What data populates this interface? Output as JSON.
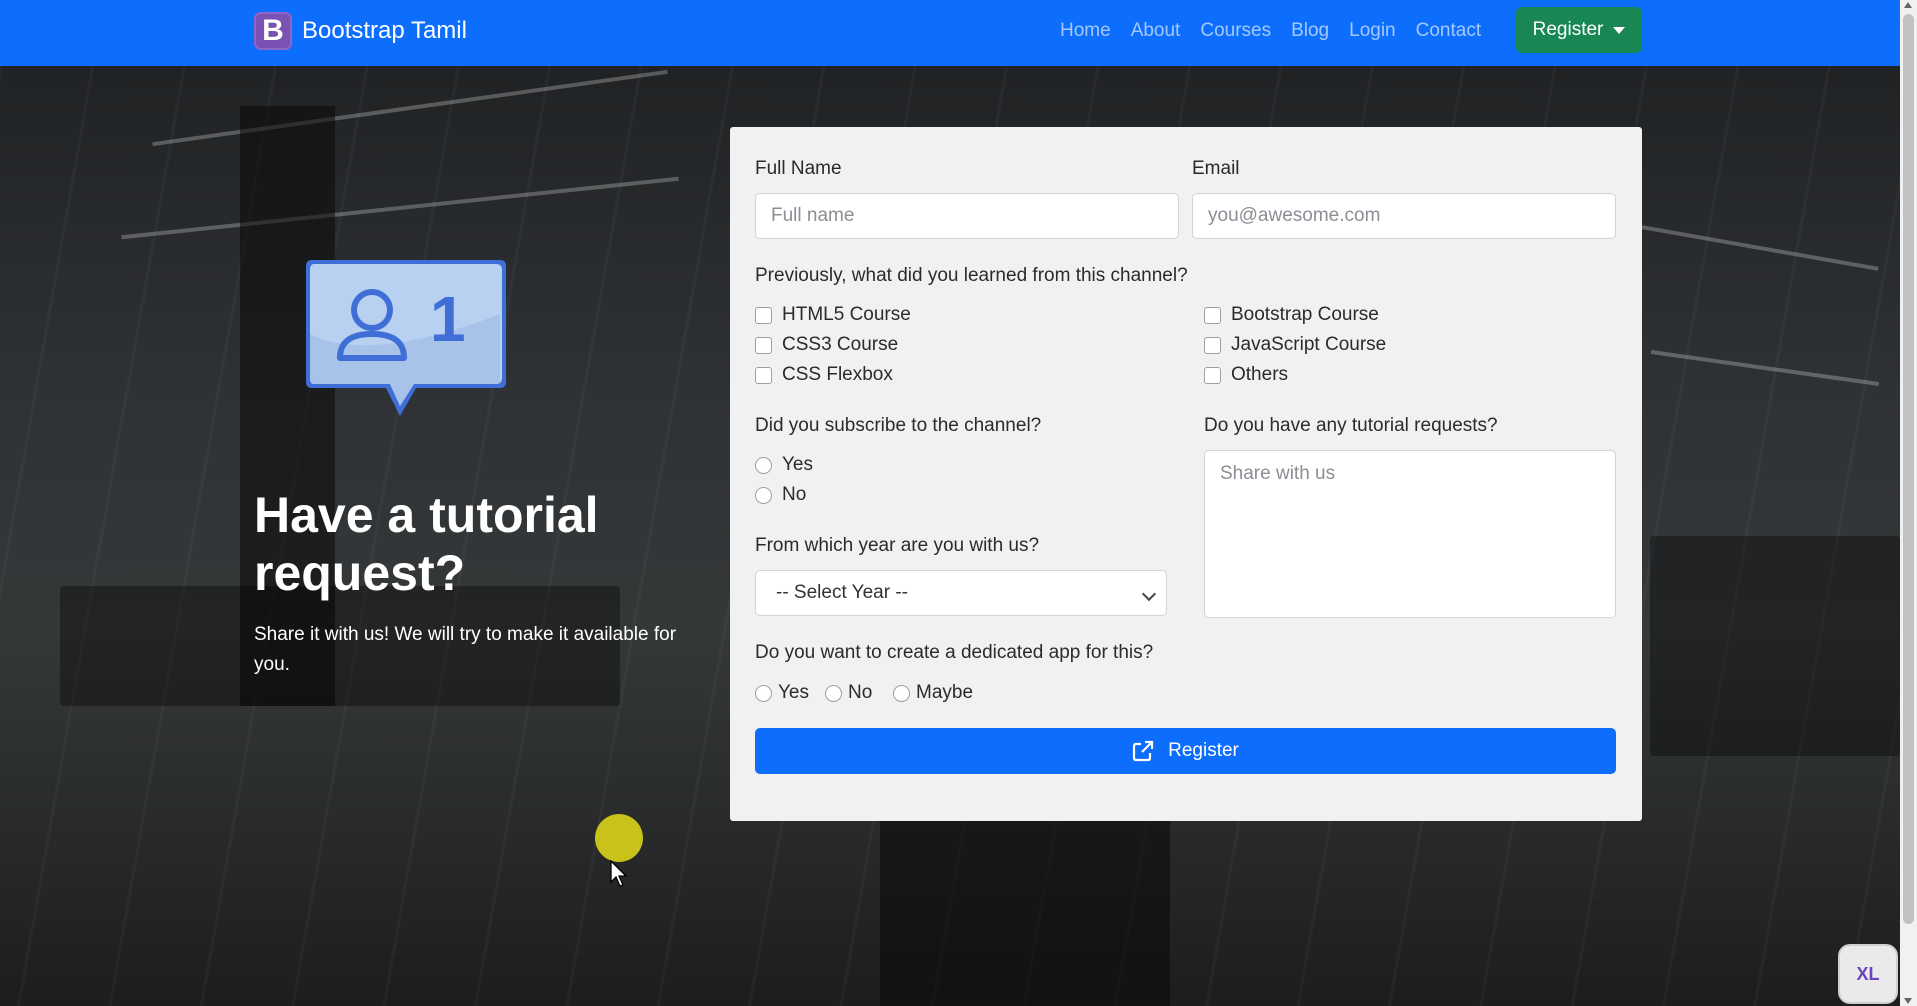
{
  "navbar": {
    "brand_letter": "B",
    "brand_name": "Bootstrap Tamil",
    "links": [
      "Home",
      "About",
      "Courses",
      "Blog",
      "Login",
      "Contact"
    ],
    "register_label": "Register"
  },
  "hero": {
    "badge_number": "1",
    "title": "Have a tutorial request?",
    "subtitle": "Share it with us! We will try to make it available for you."
  },
  "form": {
    "full_name": {
      "label": "Full Name",
      "placeholder": "Full name"
    },
    "email": {
      "label": "Email",
      "placeholder": "you@awesome.com"
    },
    "learned_question": "Previously, what did you learned from this channel?",
    "courses_left": [
      "HTML5 Course",
      "CSS3 Course",
      "CSS Flexbox"
    ],
    "courses_right": [
      "Bootstrap Course",
      "JavaScript Course",
      "Others"
    ],
    "subscribe_question": "Did you subscribe to the channel?",
    "subscribe_options": [
      "Yes",
      "No"
    ],
    "requests_question": "Do you have any tutorial requests?",
    "requests_placeholder": "Share with us",
    "year_question": "From which year are you with us?",
    "year_selected": "-- Select Year --",
    "app_question": "Do you want to create a dedicated app for this?",
    "app_options": [
      "Yes",
      "No",
      "Maybe"
    ],
    "submit_label": "Register"
  },
  "badge": {
    "label": "XL"
  },
  "colors": {
    "primary": "#0d6efd",
    "success": "#198754",
    "brand": "#7952b3"
  }
}
